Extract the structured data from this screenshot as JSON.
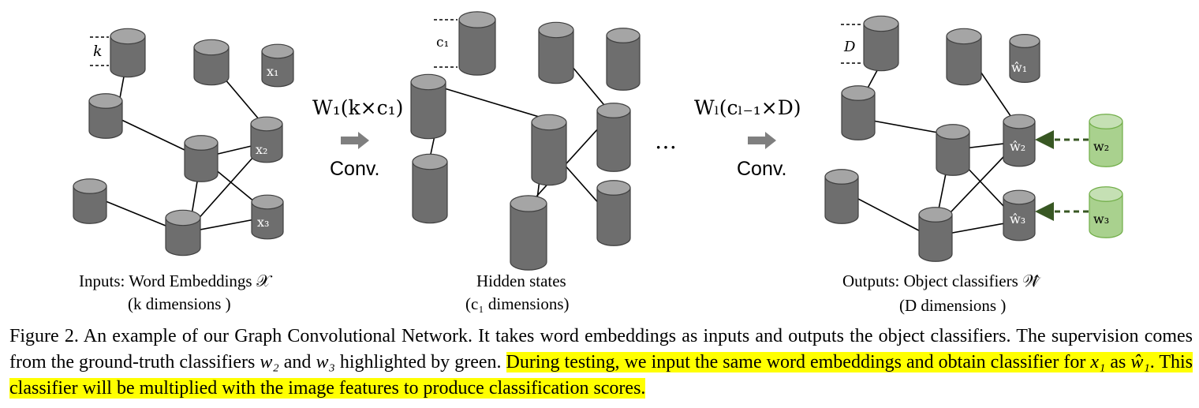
{
  "panels": {
    "input": {
      "label": "Inputs: Word Embeddings 𝒳",
      "sub": "(k dimensions )",
      "dim_mark": "k",
      "nodes": [
        "x₁",
        "x₂",
        "x₃"
      ]
    },
    "hidden": {
      "label": "Hidden states",
      "sub": "(c₁ dimensions)",
      "dim_mark": "c₁"
    },
    "output": {
      "label": "Outputs: Object classifiers 𝒲̂",
      "sub": "(D dimensions )",
      "dim_mark": "D",
      "nodes": [
        "ŵ₁",
        "ŵ₂",
        "ŵ₃"
      ],
      "gt_nodes": [
        "w₂",
        "w₃"
      ]
    }
  },
  "ops": {
    "op1": {
      "weight": "W₁(k×c₁)",
      "label": "Conv."
    },
    "ellipsis": "…",
    "op2": {
      "weight": "Wₗ(cₗ₋₁×D)",
      "label": "Conv."
    }
  },
  "caption": {
    "lead": "Figure 2. An example of our Graph Convolutional Network. It takes word embeddings as inputs and outputs the object classifiers. The supervision comes from the ground-truth classifiers ",
    "w2": "w₂",
    "and": " and ",
    "w3": "w₃",
    "mid": " highlighted by green. ",
    "hl1": "During testing, we input the same word embeddings and obtain classifier for ",
    "x1": "x₁",
    "as": " as ",
    "w1hat": "ŵ₁",
    "hl2": ". This classifier will be multiplied with the image features to produce classification scores."
  },
  "colors": {
    "cylinder_side": "#6e6e6e",
    "cylinder_top": "#a5a5a5",
    "green_side": "#a9d18e",
    "green_top": "#c5e0b4",
    "arrow_green": "#385723",
    "highlight": "#ffff00"
  }
}
